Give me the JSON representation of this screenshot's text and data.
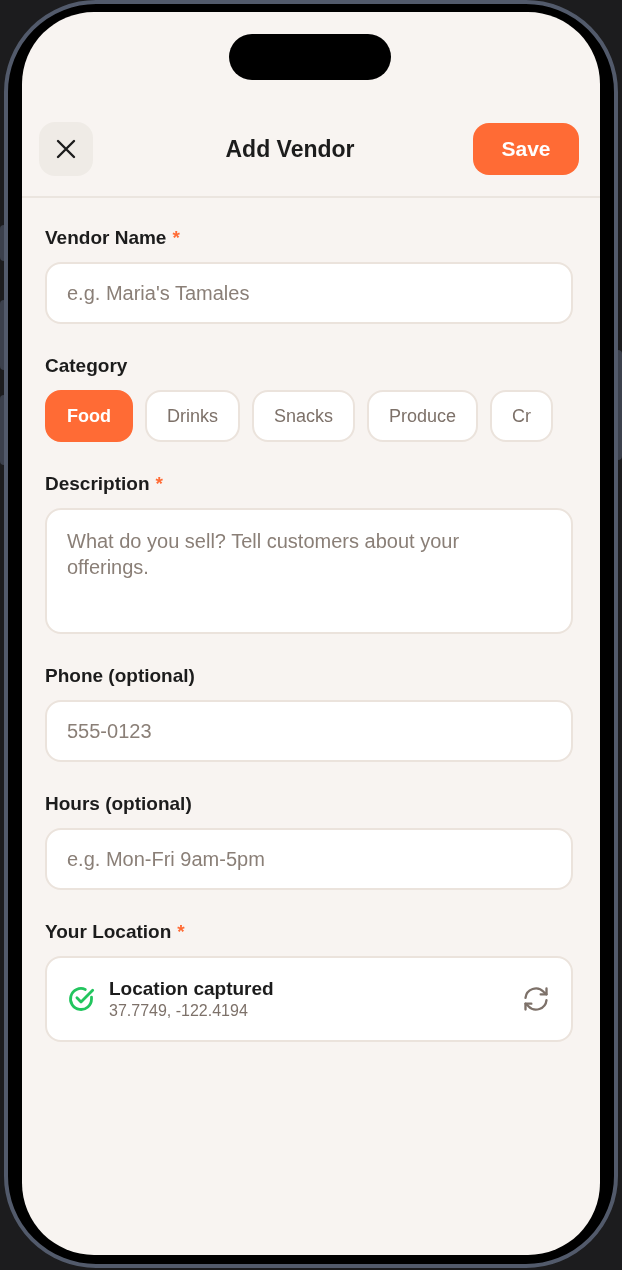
{
  "header": {
    "title": "Add Vendor",
    "save_label": "Save"
  },
  "fields": [
    {
      "kind": "input",
      "label": "Vendor Name",
      "required_mark": "*",
      "placeholder": "e.g. Maria's Tamales"
    },
    {
      "kind": "chips",
      "label": "Category",
      "chips": [
        {
          "label": "Food",
          "selected": true
        },
        {
          "label": "Drinks",
          "selected": false
        },
        {
          "label": "Snacks",
          "selected": false
        },
        {
          "label": "Produce",
          "selected": false
        },
        {
          "label": "Cr",
          "selected": false
        }
      ]
    },
    {
      "kind": "textarea",
      "label": "Description",
      "required_mark": "*",
      "placeholder": "What do you sell? Tell customers about your offerings."
    },
    {
      "kind": "input",
      "label": "Phone (optional)",
      "placeholder": "555-0123"
    },
    {
      "kind": "input",
      "label": "Hours (optional)",
      "placeholder": "e.g. Mon-Fri 9am-5pm"
    },
    {
      "kind": "location",
      "label": "Your Location",
      "required_mark": "*",
      "status": "Location captured",
      "coordinates": "37.7749, -122.4194"
    }
  ]
}
